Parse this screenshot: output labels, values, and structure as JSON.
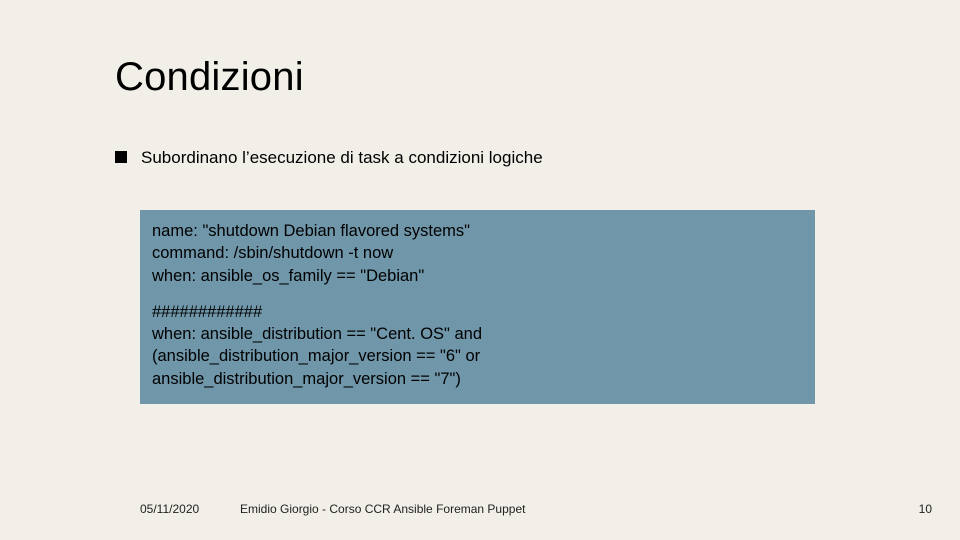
{
  "title": "Condizioni",
  "bullet": "Subordinano l’esecuzione di task a condizioni logiche",
  "code": {
    "l1": "name: \"shutdown Debian flavored systems\"",
    "l2": "command: /sbin/shutdown -t now",
    "l3": "when: ansible_os_family == \"Debian\"",
    "l4": "############",
    "l5": "when: ansible_distribution == \"Cent. OS\" and",
    "l6": "(ansible_distribution_major_version == \"6\" or",
    "l7": "ansible_distribution_major_version == \"7\")"
  },
  "footer": {
    "date": "05/11/2020",
    "center": "Emidio Giorgio - Corso CCR Ansible Foreman Puppet",
    "page": "10"
  }
}
